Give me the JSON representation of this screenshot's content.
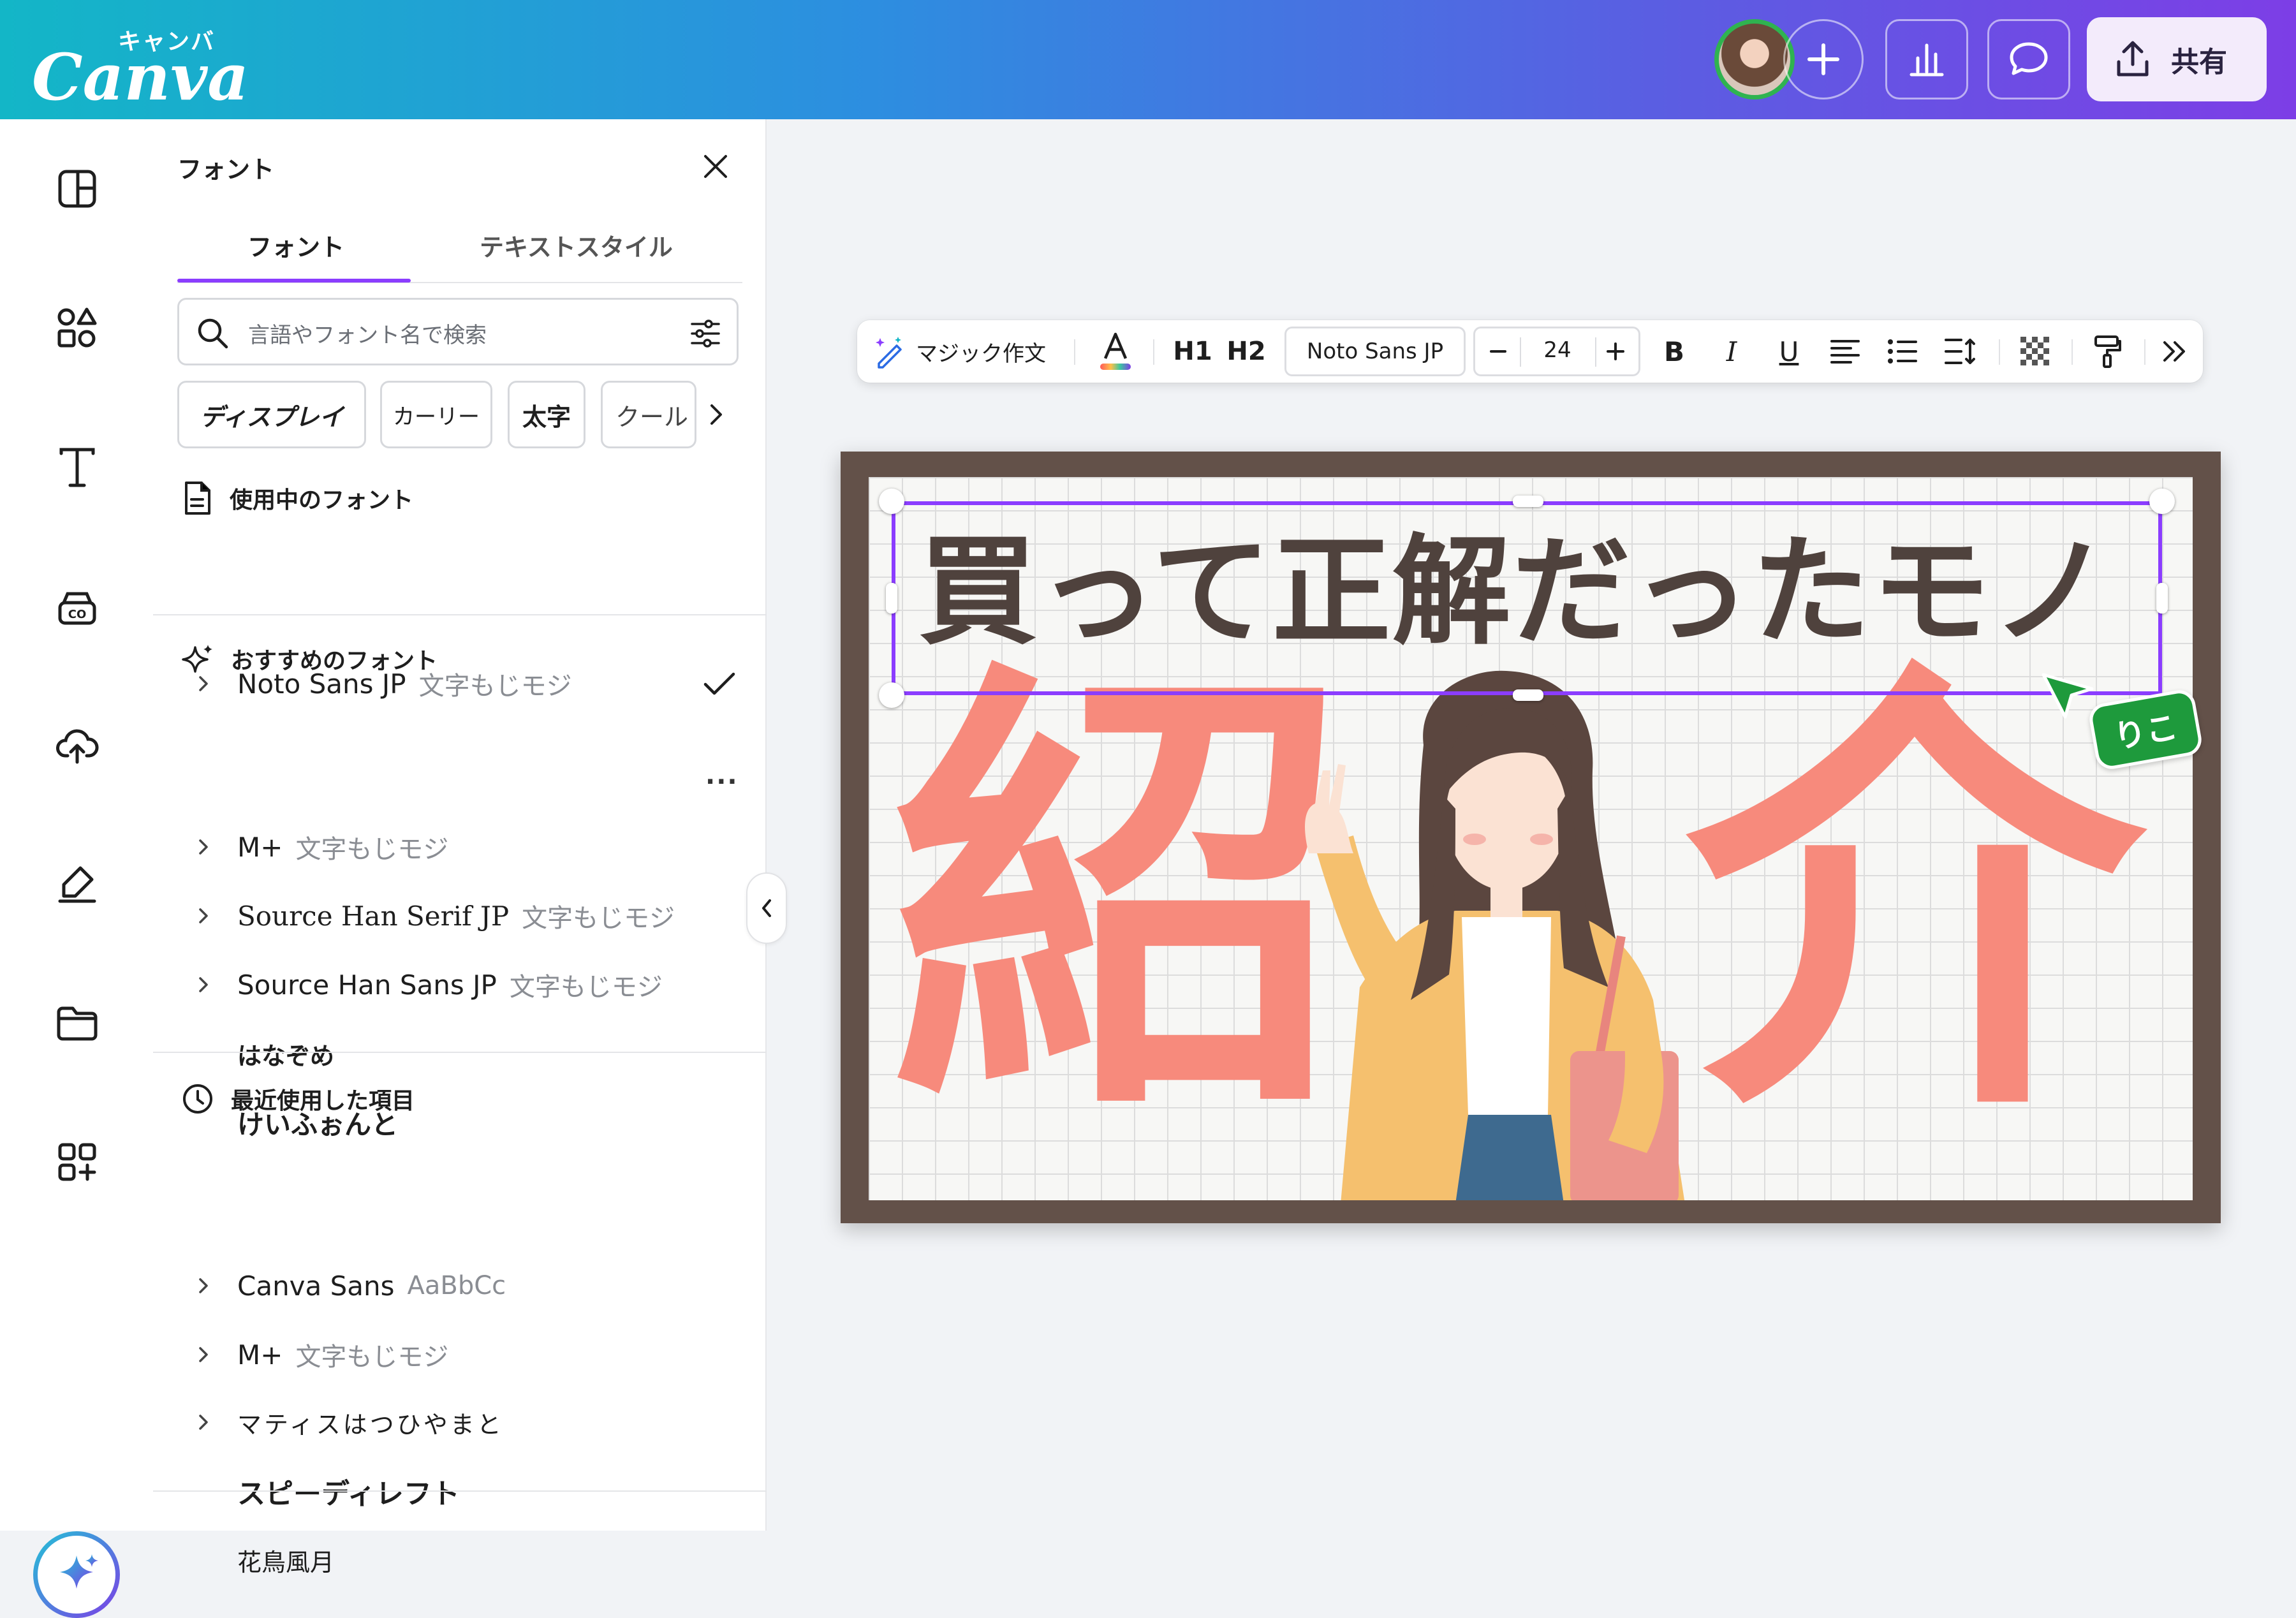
{
  "app": {
    "logo_kana": "キャンバ",
    "logo_word": "Canva"
  },
  "header": {
    "share_label": "共有"
  },
  "panel": {
    "title": "フォント",
    "tabs": [
      {
        "label": "フォント",
        "active": true
      },
      {
        "label": "テキストスタイル",
        "active": false
      }
    ],
    "search_placeholder": "言語やフォント名で検索",
    "chips": [
      "ディスプレイ",
      "カーリー",
      "太字",
      "クール"
    ],
    "in_use": {
      "heading": "使用中のフォント",
      "items": [
        {
          "name": "Noto Sans JP",
          "sample": "文字もじモジ",
          "checked": true
        }
      ]
    },
    "recommended": {
      "heading": "おすすめのフォント",
      "items": [
        {
          "name": "M+",
          "sample": "文字もじモジ",
          "expandable": true
        },
        {
          "name": "Source Han Serif JP",
          "sample": "文字もじモジ",
          "expandable": true
        },
        {
          "name": "Source Han Sans JP",
          "sample": "文字もじモジ",
          "expandable": true
        },
        {
          "name": "はなぞめ",
          "sample": "",
          "expandable": false
        },
        {
          "name": "けいふぉんと",
          "sample": "",
          "expandable": false
        }
      ]
    },
    "recent": {
      "heading": "最近使用した項目",
      "items": [
        {
          "name": "Canva Sans",
          "sample": "AaBbCc",
          "expandable": true
        },
        {
          "name": "M+",
          "sample": "文字もじモジ",
          "expandable": true
        },
        {
          "name": "マティスはつひやまと",
          "sample": "",
          "expandable": true
        },
        {
          "name": "スピーディレフト",
          "sample": "",
          "expandable": false
        },
        {
          "name": "花鳥風月",
          "sample": "",
          "expandable": false
        }
      ]
    }
  },
  "toolbar": {
    "magic_write_label": "マジック作文",
    "h1_label": "H1",
    "h2_label": "H2",
    "font_name": "Noto Sans JP",
    "font_size": "24",
    "bold_label": "B",
    "italic_label": "I",
    "underline_label": "U"
  },
  "design": {
    "title_text": "買って正解だったモノ",
    "big_left": "紹",
    "big_right": "介"
  },
  "collaborator": {
    "name": "りこ"
  },
  "colors": {
    "accent": "#8b3dff",
    "design_frame": "#635149",
    "kanji_coral": "#f78a7c",
    "title_brown": "#4f423d",
    "collaborator_green": "#1e9a3c"
  }
}
